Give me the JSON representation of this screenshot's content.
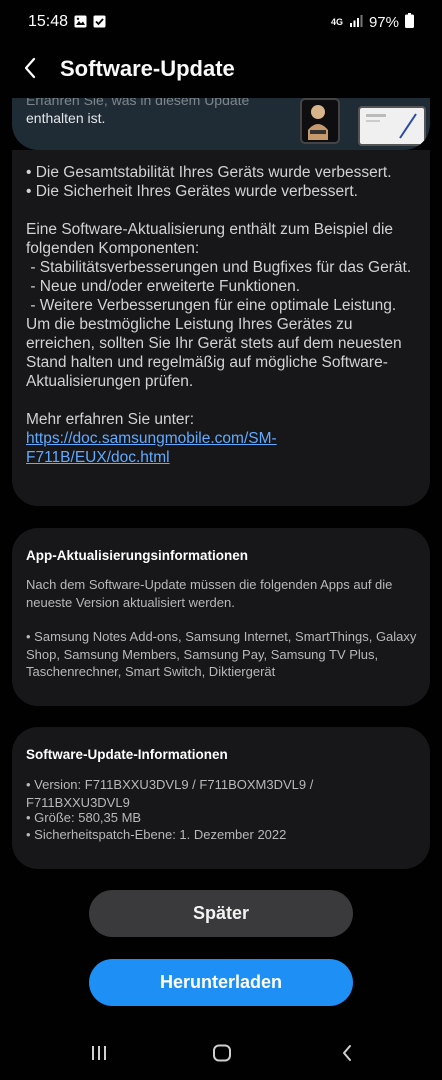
{
  "status_bar": {
    "time": "15:48",
    "network": "4G",
    "battery_percent": "97%",
    "icons": [
      "image-icon",
      "check-box-icon",
      "signal-icon",
      "battery-icon"
    ]
  },
  "header": {
    "title": "Software-Update",
    "back_icon": "chevron-left-icon"
  },
  "banner": {
    "text_line1": "Erfahren Sie, was in diesem Update",
    "text_line2": "enthalten ist."
  },
  "release_notes": {
    "text": "• Die Gesamtstabilität Ihres Geräts wurde verbessert.\n• Die Sicherheit Ihres Gerätes wurde verbessert.\n\nEine Software-Aktualisierung enthält zum Beispiel die folgenden Komponenten:\n - Stabilitätsverbesserungen und Bugfixes für das Gerät.\n - Neue und/oder erweiterte Funktionen.\n - Weitere Verbesserungen für eine optimale Leistung.\nUm die bestmögliche Leistung Ihres Gerätes zu erreichen, sollten Sie Ihr Gerät stets auf dem neuesten Stand halten und regelmäßig auf mögliche Software-Aktualisierungen prüfen.\n\nMehr erfahren Sie unter:",
    "link": "https://doc.samsungmobile.com/SM-F711B/EUX/doc.html"
  },
  "app_update": {
    "heading": "App-Aktualisierungsinformationen",
    "intro": "Nach dem Software-Update müssen die folgenden Apps auf die neueste Version aktualisiert werden.",
    "apps": "• Samsung Notes Add-ons, Samsung Internet, SmartThings, Galaxy Shop, Samsung Members, Samsung Pay, Samsung TV Plus, Taschenrechner, Smart Switch, Diktiergerät"
  },
  "update_info": {
    "heading": "Software-Update-Informationen",
    "version": "• Version: F711BXXU3DVL9 / F711BOXM3DVL9 / F711BXXU3DVL9",
    "size": "• Größe: 580,35 MB",
    "patch": "• Sicherheitspatch-Ebene: 1. Dezember 2022"
  },
  "buttons": {
    "later": "Später",
    "download": "Herunterladen"
  },
  "nav_bar": {
    "recents_icon": "recents-icon",
    "home_icon": "home-icon",
    "back_icon": "back-icon"
  },
  "colors": {
    "background": "#010101",
    "card": "#17171a",
    "accent": "#1e8ff4",
    "link": "#61aaff"
  }
}
